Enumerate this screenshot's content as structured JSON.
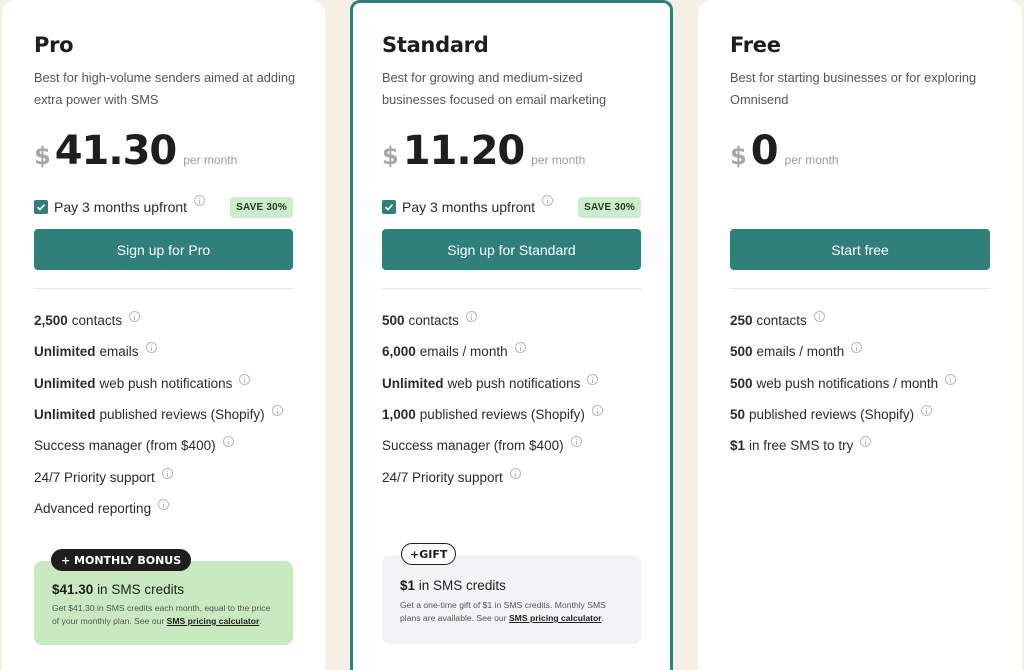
{
  "currency_symbol": "$",
  "accent_color": "#2f7f7a",
  "plans": {
    "pro": {
      "name": "Pro",
      "description": "Best for high-volume senders aimed at adding extra power with SMS",
      "amount": "41.30",
      "per": "per month",
      "upfront_label": "Pay 3 months upfront",
      "upfront_checked": true,
      "save_badge": "SAVE 30%",
      "cta": "Sign up for Pro",
      "features": [
        {
          "bold": "2,500",
          "text": "contacts"
        },
        {
          "bold": "Unlimited",
          "text": "emails"
        },
        {
          "bold": "Unlimited",
          "text": "web push notifications"
        },
        {
          "bold": "Unlimited",
          "text": "published reviews (Shopify)"
        },
        {
          "bold": "",
          "text": "Success manager (from $400)"
        },
        {
          "bold": "",
          "text": "24/7 Priority support"
        },
        {
          "bold": "",
          "text": "Advanced reporting"
        }
      ],
      "bonus": {
        "pill": "+ MONTHLY BONUS",
        "title_bold": "$41.30",
        "title_rest": "in SMS credits",
        "text": "Get $41.30 in SMS credits each month, equal to the price of your monthly plan. See our",
        "link": "SMS pricing calculator",
        "text_end": "."
      }
    },
    "standard": {
      "name": "Standard",
      "description": "Best for growing and medium-sized businesses focused on email marketing",
      "amount": "11.20",
      "per": "per month",
      "upfront_label": "Pay 3 months upfront",
      "upfront_checked": true,
      "save_badge": "SAVE 30%",
      "cta": "Sign up for Standard",
      "features": [
        {
          "bold": "500",
          "text": "contacts"
        },
        {
          "bold": "6,000",
          "text": "emails / month"
        },
        {
          "bold": "Unlimited",
          "text": "web push notifications"
        },
        {
          "bold": "1,000",
          "text": "published reviews (Shopify)"
        },
        {
          "bold": "",
          "text": "Success manager (from $400)"
        },
        {
          "bold": "",
          "text": "24/7 Priority support"
        }
      ],
      "gift": {
        "pill": "+GIFT",
        "title_bold": "$1",
        "title_rest": "in SMS credits",
        "text": "Get a one-time gift of $1 in SMS credits. Monthly SMS plans are available. See our",
        "link": "SMS pricing calculator",
        "text_end": "."
      }
    },
    "free": {
      "name": "Free",
      "description": "Best for starting businesses or for exploring Omnisend",
      "amount": "0",
      "per": "per month",
      "cta": "Start free",
      "features": [
        {
          "bold": "250",
          "text": "contacts"
        },
        {
          "bold": "500",
          "text": "emails / month"
        },
        {
          "bold": "500",
          "text": "web push notifications / month"
        },
        {
          "bold": "50",
          "text": "published reviews (Shopify)"
        },
        {
          "bold": "$1",
          "text": "in free SMS to try"
        }
      ]
    }
  }
}
